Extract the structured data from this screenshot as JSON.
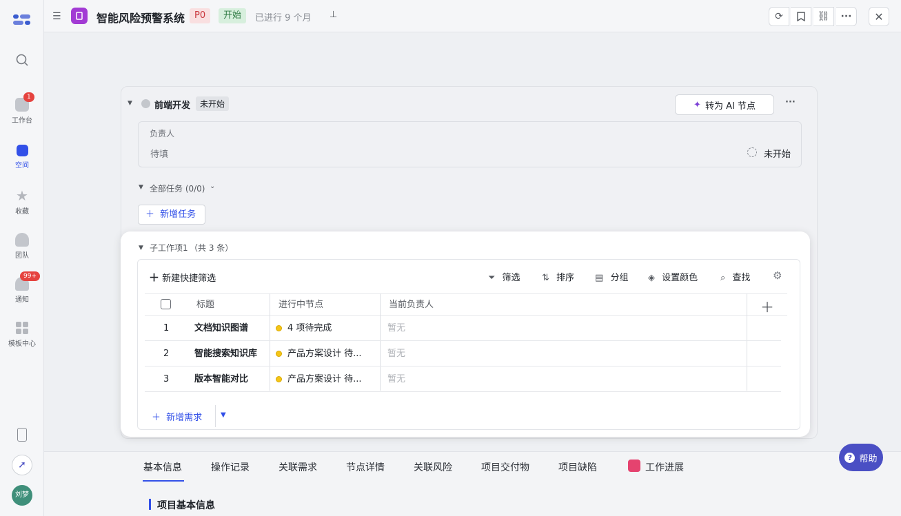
{
  "sidebar": {
    "items": [
      {
        "label": "工作台",
        "badge": "1"
      },
      {
        "label": "空间"
      },
      {
        "label": "收藏"
      },
      {
        "label": "团队"
      },
      {
        "label": "通知",
        "badge": "99+"
      },
      {
        "label": "模板中心"
      }
    ],
    "avatar": "刘梦"
  },
  "header": {
    "title": "智能风险预警系统",
    "priority": "P0",
    "status": "开始",
    "duration": "已进行 9 个月"
  },
  "node": {
    "name": "前端开发",
    "status": "未开始",
    "ai_button": "转为 AI 节点",
    "owner_label": "负责人",
    "owner_value": "待填",
    "owner_status": "未开始",
    "tasks_label": "全部任务 (0/0)",
    "add_task": "新增任务"
  },
  "subitems": {
    "title": "子工作项1",
    "count": "（共 3 条）",
    "toolbar": {
      "new_filter": "新建快捷筛选",
      "filter": "筛选",
      "sort": "排序",
      "group": "分组",
      "color": "设置颜色",
      "find": "查找"
    },
    "columns": [
      "标题",
      "进行中节点",
      "当前负责人"
    ],
    "rows": [
      {
        "no": "1",
        "title": "文档知识图谱",
        "node": "4 项待完成",
        "owner": "暂无"
      },
      {
        "no": "2",
        "title": "智能搜索知识库",
        "node": "产品方案设计 待...",
        "owner": "暂无"
      },
      {
        "no": "3",
        "title": "版本智能对比",
        "node": "产品方案设计 待...",
        "owner": "暂无"
      }
    ],
    "add_requirement": "新增需求"
  },
  "tabs": [
    "基本信息",
    "操作记录",
    "关联需求",
    "节点详情",
    "关联风险",
    "项目交付物",
    "项目缺陷",
    "工作进展"
  ],
  "section_title": "项目基本信息",
  "help": "帮助",
  "colors": {
    "accent": "#3250e8",
    "in_progress": "#f5c518",
    "purple": "#7b3fd6"
  }
}
